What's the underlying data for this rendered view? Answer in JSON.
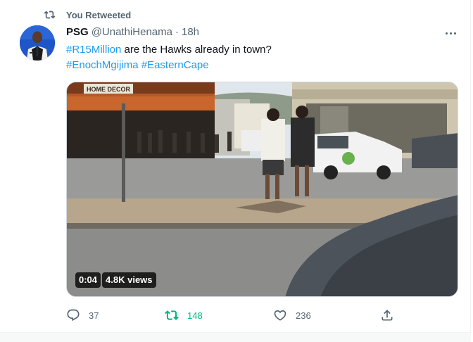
{
  "retweet_banner": {
    "label": "You Retweeted",
    "icon": "retweet-icon"
  },
  "tweet": {
    "author_name": "PSG",
    "author_handle": "@UnathiHenama",
    "separator": "·",
    "time": "18h",
    "text_line1_hashtag": "#R15Million",
    "text_line1_rest": " are the Hawks already in town?",
    "hashtag_2": "#EnochMgijima",
    "hashtag_3": "#EasternCape",
    "media": {
      "type": "video",
      "duration": "0:04",
      "views": "4.8K views",
      "store_sign": "HOME DECOR"
    },
    "actions": {
      "reply_count": "37",
      "retweet_count": "148",
      "like_count": "236"
    }
  },
  "colors": {
    "accent": "#1d9bf0",
    "retweet_active": "#00ba7c",
    "muted": "#536471"
  }
}
